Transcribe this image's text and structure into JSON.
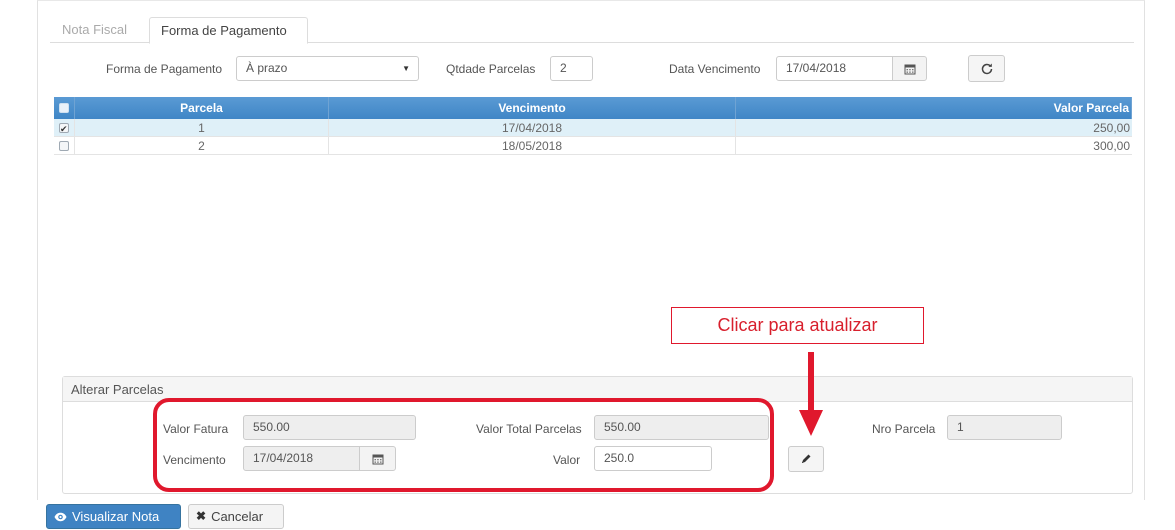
{
  "tabs": [
    {
      "label": "Nota Fiscal"
    },
    {
      "label": "Forma de Pagamento"
    }
  ],
  "form": {
    "payment_label": "Forma de Pagamento",
    "payment_value": "À prazo",
    "installments_label": "Qtdade Parcelas",
    "installments_value": "2",
    "due_label": "Data Vencimento",
    "due_value": "17/04/2018"
  },
  "grid": {
    "headers": [
      "Parcela",
      "Vencimento",
      "Valor Parcela"
    ],
    "rows": [
      {
        "parcela": "1",
        "vencimento": "17/04/2018",
        "valor": "250,00",
        "checked": true
      },
      {
        "parcela": "2",
        "vencimento": "18/05/2018",
        "valor": "300,00",
        "checked": false
      }
    ]
  },
  "panel": {
    "title": "Alterar Parcelas",
    "valor_fatura_label": "Valor Fatura",
    "valor_fatura_value": "550.00",
    "valor_total_label": "Valor Total Parcelas",
    "valor_total_value": "550.00",
    "nro_parcela_label": "Nro Parcela",
    "nro_parcela_value": "1",
    "vencimento_label": "Vencimento",
    "vencimento_value": "17/04/2018",
    "valor_label": "Valor",
    "valor_value": "250.0"
  },
  "annotation": {
    "text": "Clicar para atualizar",
    "color": "#e0182d"
  },
  "footer": {
    "view_label": "Visualizar Nota",
    "cancel_label": "Cancelar"
  },
  "icons": [
    "calendar-icon",
    "refresh-icon",
    "pencil-icon",
    "eye-icon",
    "times-icon",
    "caret-down-icon"
  ],
  "colors": {
    "header_blue": "#428bca",
    "selected_row": "#dff0f8",
    "primary_button": "#3f83c3"
  }
}
